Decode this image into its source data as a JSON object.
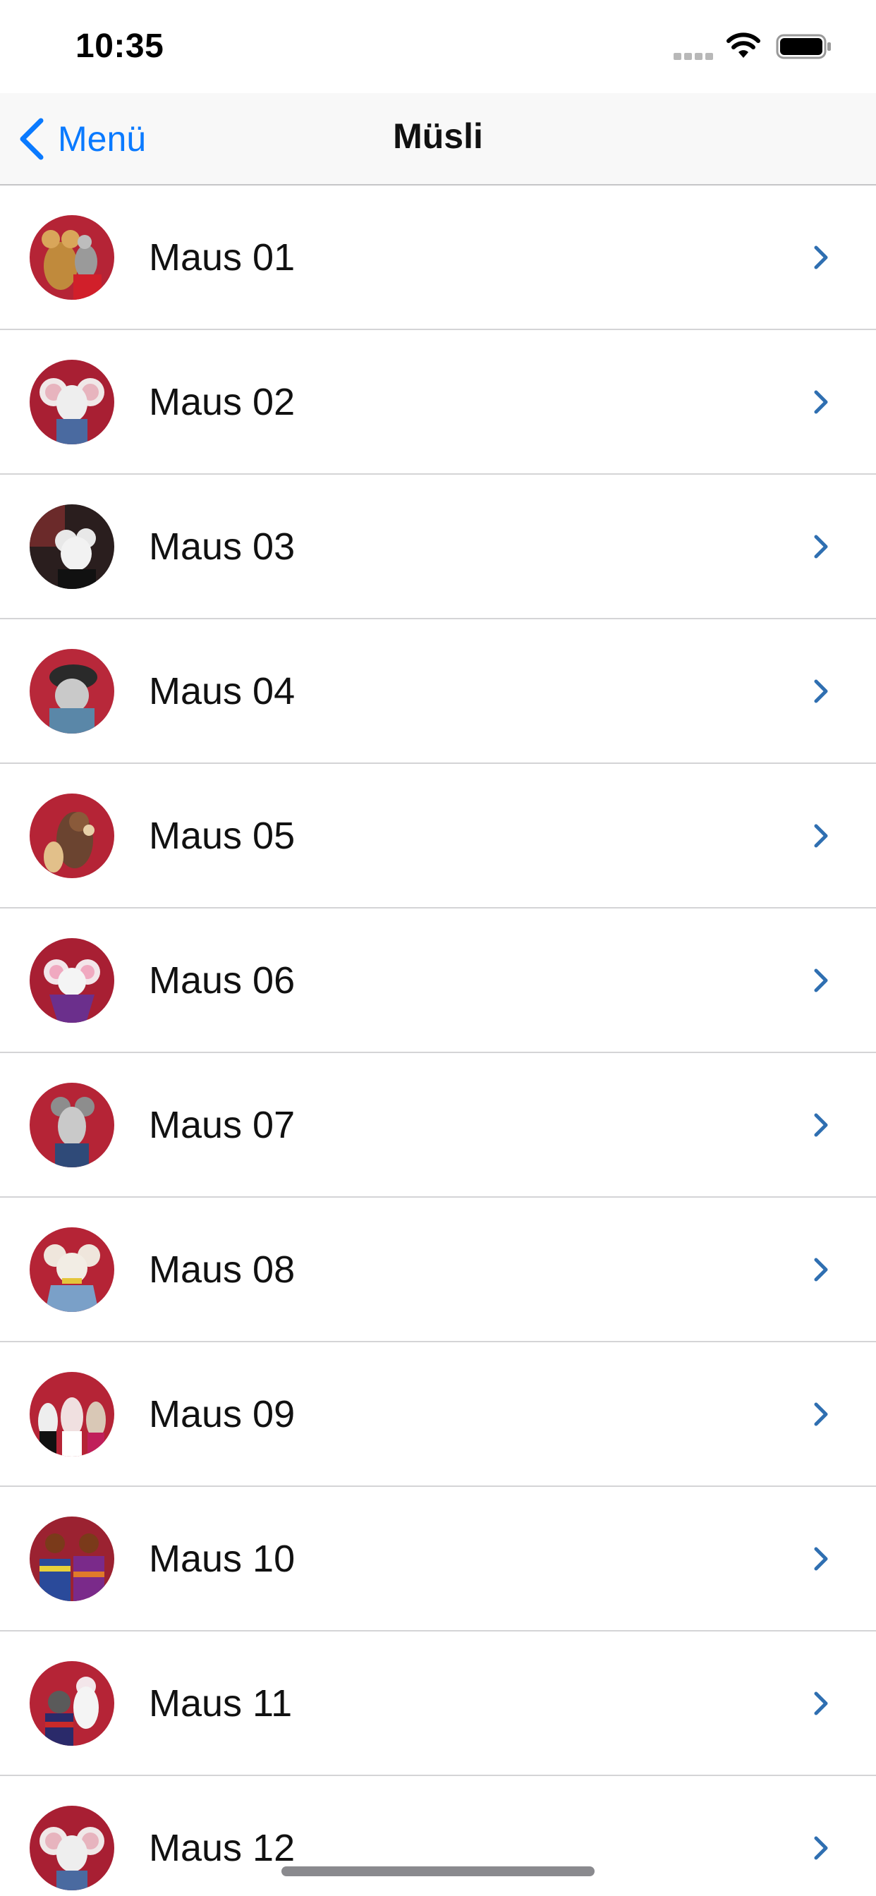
{
  "status_bar": {
    "time": "10:35"
  },
  "nav": {
    "back_label": "Menü",
    "title": "Müsli"
  },
  "colors": {
    "accent": "#0a7aff",
    "row_chevron": "#2f6fb1",
    "separator": "#d4d4d6",
    "avatar_background": "#b52436"
  },
  "icons": {
    "back": "chevron-left-icon",
    "row": "chevron-right-icon",
    "status": [
      "cellular-signal-icon",
      "wifi-icon",
      "battery-icon"
    ]
  },
  "list": {
    "items": [
      {
        "label": "Maus 01"
      },
      {
        "label": "Maus 02"
      },
      {
        "label": "Maus 03"
      },
      {
        "label": "Maus 04"
      },
      {
        "label": "Maus 05"
      },
      {
        "label": "Maus 06"
      },
      {
        "label": "Maus 07"
      },
      {
        "label": "Maus 08"
      },
      {
        "label": "Maus 09"
      },
      {
        "label": "Maus 10"
      },
      {
        "label": "Maus 11"
      },
      {
        "label": "Maus 12"
      }
    ]
  }
}
